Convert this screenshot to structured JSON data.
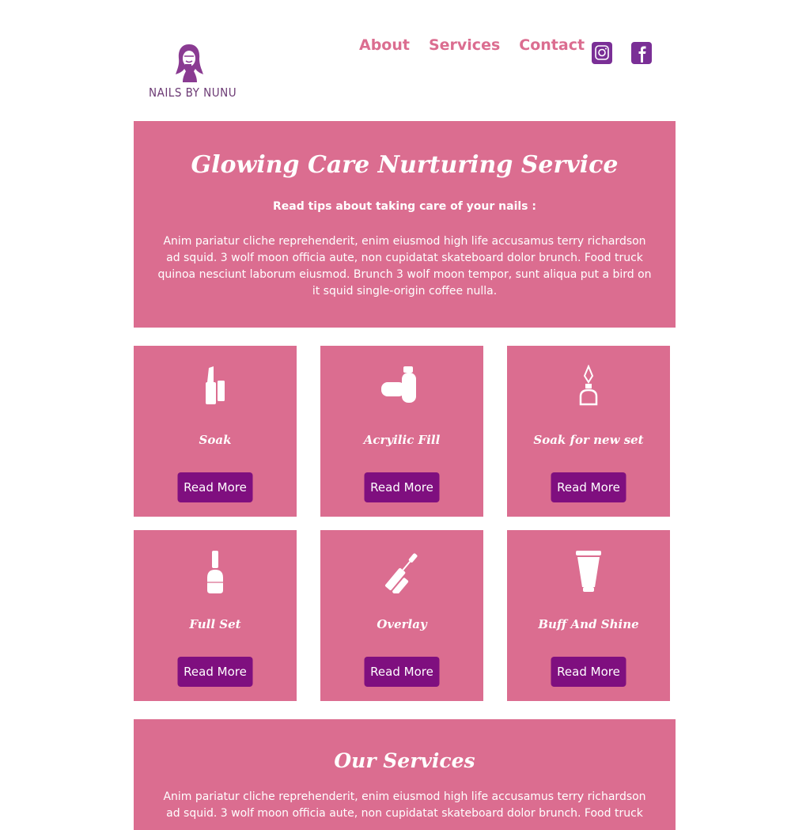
{
  "brand": {
    "name": "NAILS BY NUNU",
    "logo_icon": "woman-portrait-icon"
  },
  "nav": {
    "about": "About",
    "services": "Services",
    "contact": "Contact"
  },
  "social": {
    "instagram_icon": "instagram-icon",
    "facebook_icon": "facebook-icon",
    "color": "#7a2f96"
  },
  "hero": {
    "title": "Glowing Care Nurturing Service",
    "subtitle": "Read tips about taking care of your nails :",
    "body": "Anim pariatur cliche reprehenderit, enim eiusmod high life accusamus terry richardson ad squid. 3 wolf moon officia aute, non cupidatat skateboard dolor brunch. Food truck quinoa nesciunt laborum eiusmod. Brunch 3 wolf moon tempor, sunt aliqua put a bird on it squid single-origin coffee nulla."
  },
  "cards": [
    {
      "title": "Soak",
      "button": "Read More",
      "icon": "lipstick-icon"
    },
    {
      "title": "Acryilic Fill",
      "button": "Read More",
      "icon": "nail-polish-lying-icon"
    },
    {
      "title": "Soak for new set",
      "button": "Read More",
      "icon": "perfume-bottle-icon"
    },
    {
      "title": "Full Set",
      "button": "Read More",
      "icon": "nail-polish-bottle-icon"
    },
    {
      "title": "Overlay",
      "button": "Read More",
      "icon": "mascara-brush-icon"
    },
    {
      "title": "Buff And Shine",
      "button": "Read More",
      "icon": "cream-tube-icon"
    }
  ],
  "services": {
    "title": "Our Services",
    "body": "Anim pariatur cliche reprehenderit, enim eiusmod high life accusamus terry richardson ad squid. 3 wolf moon officia aute, non cupidatat skateboard dolor brunch. Food truck"
  },
  "colors": {
    "pink": "#db6d90",
    "purple_button": "#7f0f7f",
    "nav_text": "#db6d90"
  }
}
